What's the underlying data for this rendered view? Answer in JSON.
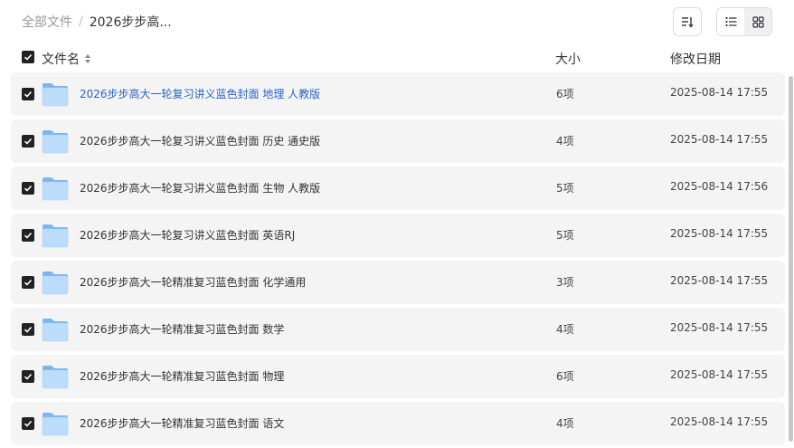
{
  "breadcrumb": {
    "root": "全部文件",
    "separator": "/",
    "current": "2026步步高..."
  },
  "columns": {
    "name": "文件名",
    "size": "大小",
    "modified": "修改日期"
  },
  "colors": {
    "row_bg": "#f4f4f5",
    "link": "#2a63c9",
    "folder_light": "#bcdcfb",
    "folder_dark": "#79b6f3"
  },
  "rows": [
    {
      "name": "2026步步高大一轮复习讲义蓝色封面 地理 人教版",
      "size": "6项",
      "date": "2025-08-14 17:55",
      "highlight": true
    },
    {
      "name": "2026步步高大一轮复习讲义蓝色封面 历史 通史版",
      "size": "4项",
      "date": "2025-08-14 17:55"
    },
    {
      "name": "2026步步高大一轮复习讲义蓝色封面 生物 人教版",
      "size": "5项",
      "date": "2025-08-14 17:56"
    },
    {
      "name": "2026步步高大一轮复习讲义蓝色封面 英语RJ",
      "size": "5项",
      "date": "2025-08-14 17:55"
    },
    {
      "name": "2026步步高大一轮精准复习蓝色封面 化学通用",
      "size": "3项",
      "date": "2025-08-14 17:55"
    },
    {
      "name": "2026步步高大一轮精准复习蓝色封面 数学",
      "size": "4项",
      "date": "2025-08-14 17:55"
    },
    {
      "name": "2026步步高大一轮精准复习蓝色封面 物理",
      "size": "6项",
      "date": "2025-08-14 17:55"
    },
    {
      "name": "2026步步高大一轮精准复习蓝色封面 语文",
      "size": "4项",
      "date": "2025-08-14 17:55"
    }
  ]
}
